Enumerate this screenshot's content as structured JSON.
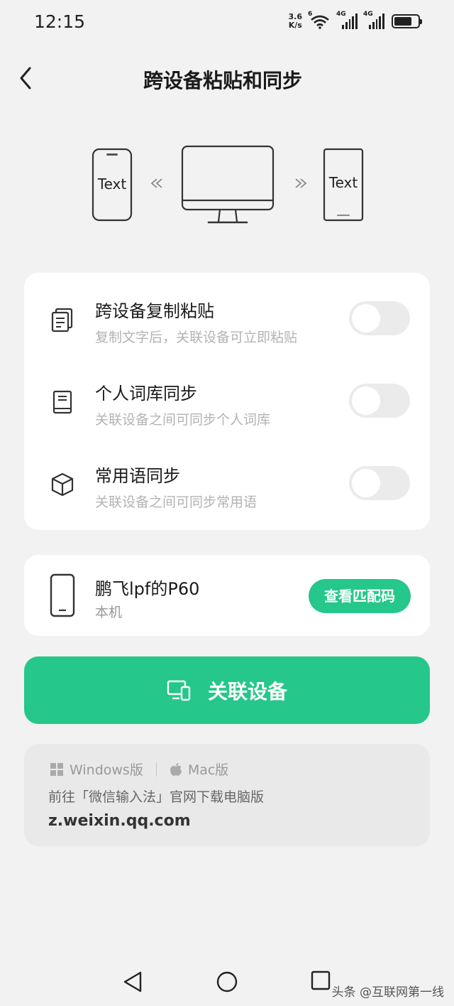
{
  "status_bar": {
    "time": "12:15",
    "net_speed_value": "3.6",
    "net_speed_unit": "K/s",
    "wifi_label": "6",
    "sim1_label": "4G",
    "sim2_label": "4G"
  },
  "header": {
    "title": "跨设备粘贴和同步"
  },
  "illustration": {
    "left_phone_text": "Text",
    "right_phone_text": "Text"
  },
  "settings": [
    {
      "title": "跨设备复制粘贴",
      "desc": "复制文字后，关联设备可立即粘贴",
      "icon": "copy-icon",
      "enabled": false
    },
    {
      "title": "个人词库同步",
      "desc": "关联设备之间可同步个人词库",
      "icon": "book-icon",
      "enabled": false
    },
    {
      "title": "常用语同步",
      "desc": "关联设备之间可同步常用语",
      "icon": "cube-icon",
      "enabled": false
    }
  ],
  "device": {
    "name": "鹏飞lpf的P60",
    "sub": "本机",
    "pair_button": "查看匹配码"
  },
  "link_button": {
    "label": "关联设备"
  },
  "download": {
    "windows_label": "Windows版",
    "mac_label": "Mac版",
    "hint": "前往「微信输入法」官网下载电脑版",
    "url": "z.weixin.qq.com"
  },
  "watermark": "头条 @互联网第一线",
  "colors": {
    "accent": "#25c78a",
    "background": "#f2f2f2",
    "card": "#ffffff"
  }
}
